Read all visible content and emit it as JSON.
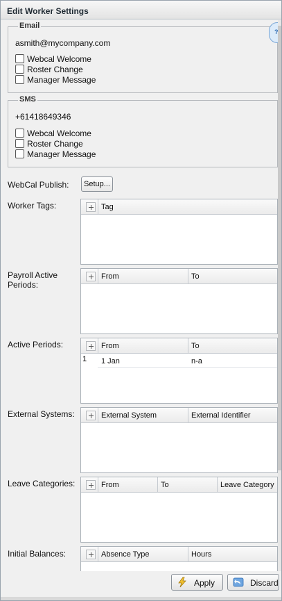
{
  "window": {
    "title": "Edit Worker Settings"
  },
  "email": {
    "legend": "Email",
    "address": "asmith@mycompany.com",
    "options": [
      {
        "label": "Webcal Welcome",
        "checked": false
      },
      {
        "label": "Roster Change",
        "checked": false
      },
      {
        "label": "Manager Message",
        "checked": false
      }
    ]
  },
  "sms": {
    "legend": "SMS",
    "number": "+61418649346",
    "options": [
      {
        "label": "Webcal Welcome",
        "checked": false
      },
      {
        "label": "Roster Change",
        "checked": false
      },
      {
        "label": "Manager Message",
        "checked": false
      }
    ]
  },
  "webcal": {
    "label": "WebCal Publish:",
    "button": "Setup..."
  },
  "worker_tags": {
    "label": "Worker Tags:",
    "columns": [
      "Tag"
    ]
  },
  "payroll_periods": {
    "label": "Payroll Active Periods:",
    "label_line1": "Payroll Active",
    "label_line2": "Periods:",
    "columns": [
      "From",
      "To"
    ]
  },
  "active_periods": {
    "label": "Active Periods:",
    "columns": [
      "From",
      "To"
    ],
    "rows": [
      {
        "num": "1",
        "from": "1 Jan",
        "to": "n-a"
      }
    ]
  },
  "external_systems": {
    "label": "External Systems:",
    "columns": [
      "External System",
      "External Identifier"
    ]
  },
  "leave_categories": {
    "label": "Leave Categories:",
    "columns": [
      "From",
      "To",
      "Leave Category"
    ]
  },
  "initial_balances": {
    "label": "Initial Balances:",
    "columns": [
      "Absence Type",
      "Hours"
    ]
  },
  "footer": {
    "apply": "Apply",
    "discard": "Discard"
  },
  "icons": {
    "help": "help-icon",
    "apply": "lightning-icon",
    "discard": "undo-arrow-icon"
  }
}
